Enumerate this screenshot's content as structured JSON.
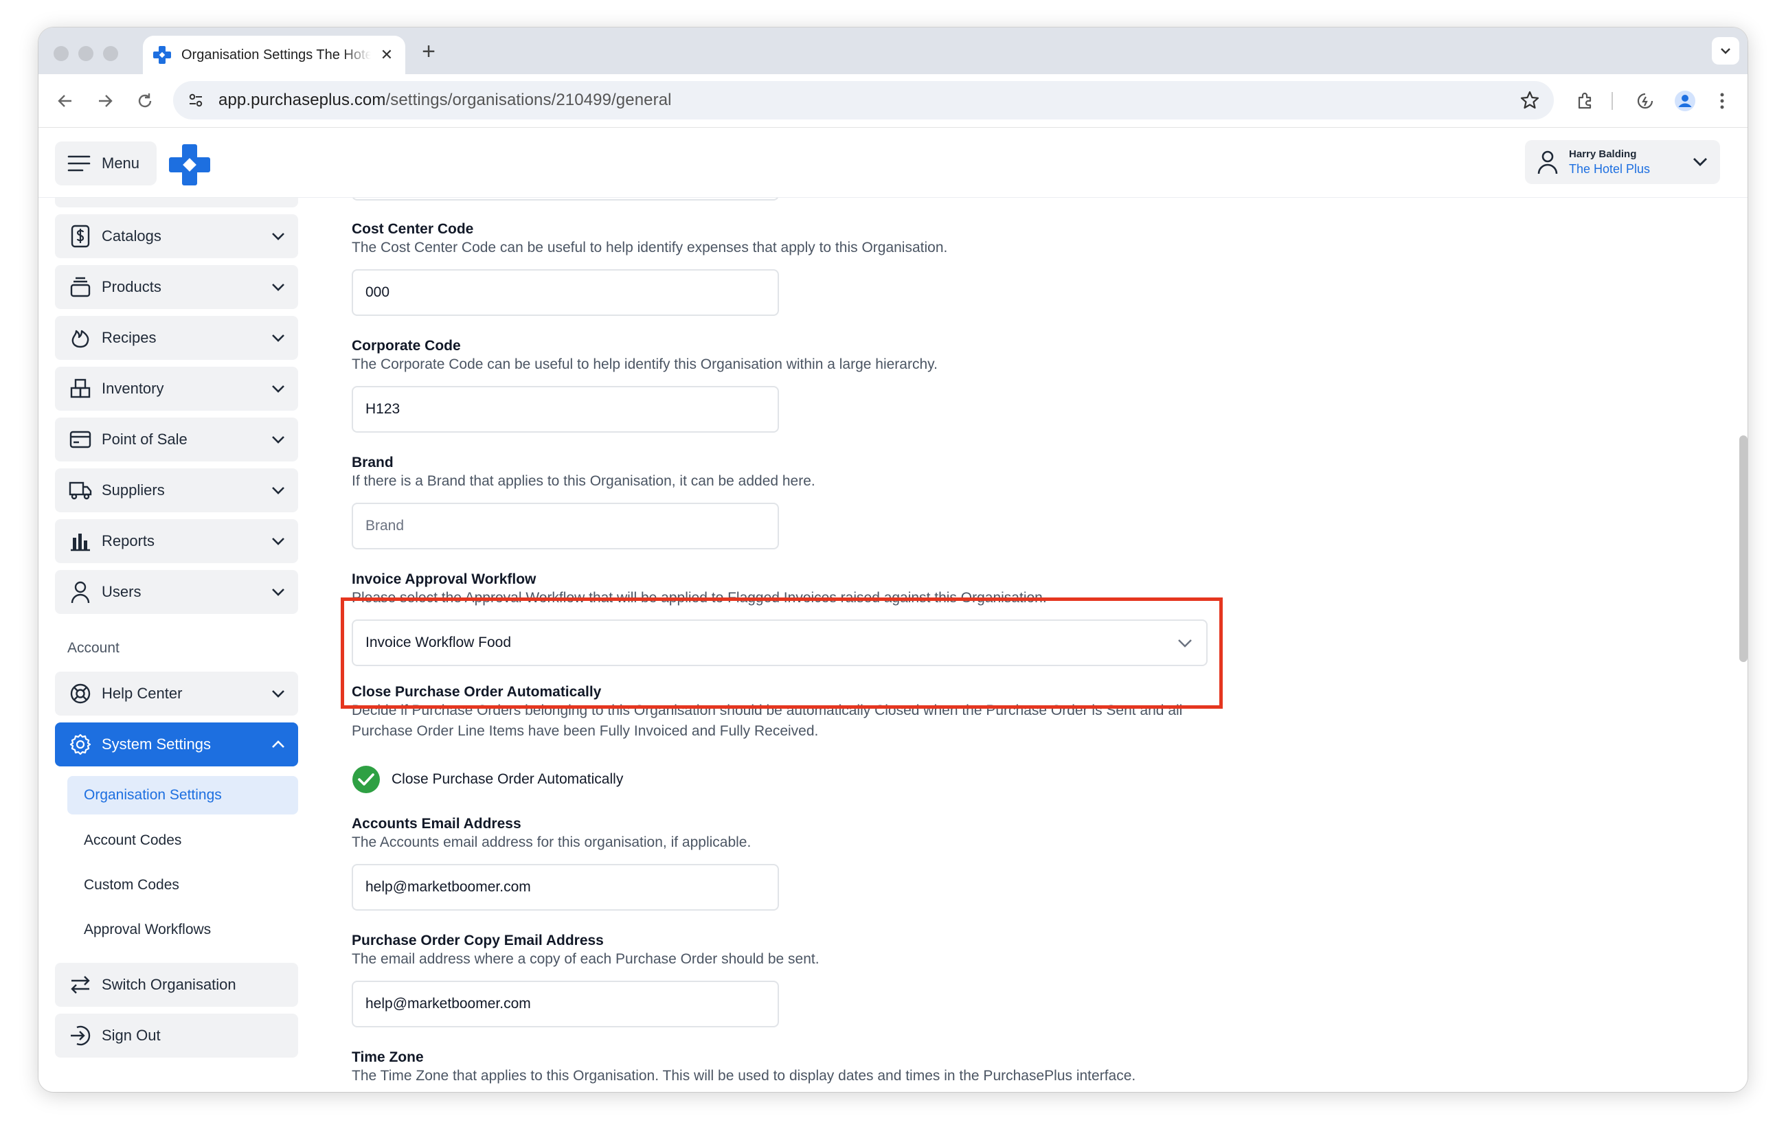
{
  "browser": {
    "tab_title": "Organisation Settings The Hotel Plus",
    "url_host": "app.purchaseplus.com",
    "url_path": "/settings/organisations/210499/general"
  },
  "header": {
    "menu_label": "Menu",
    "user_name": "Harry Balding",
    "user_org": "The Hotel Plus"
  },
  "sidebar": {
    "items": [
      {
        "label": "Catalogs",
        "icon": "dollar-doc-icon"
      },
      {
        "label": "Products",
        "icon": "stack-icon"
      },
      {
        "label": "Recipes",
        "icon": "flame-icon"
      },
      {
        "label": "Inventory",
        "icon": "boxes-icon"
      },
      {
        "label": "Point of Sale",
        "icon": "card-icon"
      },
      {
        "label": "Suppliers",
        "icon": "truck-icon"
      },
      {
        "label": "Reports",
        "icon": "bar-chart-icon"
      },
      {
        "label": "Users",
        "icon": "user-icon"
      }
    ],
    "account_heading": "Account",
    "help_center": "Help Center",
    "system_settings": "System Settings",
    "sub_items": [
      "Organisation Settings",
      "Account Codes",
      "Custom Codes",
      "Approval Workflows"
    ],
    "switch_org": "Switch Organisation",
    "sign_out": "Sign Out"
  },
  "form": {
    "cost_center": {
      "title": "Cost Center Code",
      "desc": "The Cost Center Code can be useful to help identify expenses that apply to this Organisation.",
      "value": "000"
    },
    "corporate_code": {
      "title": "Corporate Code",
      "desc": "The Corporate Code can be useful to help identify this Organisation within a large hierarchy.",
      "value": "H123"
    },
    "brand": {
      "title": "Brand",
      "desc": "If there is a Brand that applies to this Organisation, it can be added here.",
      "placeholder": "Brand"
    },
    "invoice_workflow": {
      "title": "Invoice Approval Workflow",
      "desc": "Please select the Approval Workflow that will be applied to Flagged Invoices raised against this Organisation.",
      "value": "Invoice Workflow Food"
    },
    "close_po": {
      "title": "Close Purchase Order Automatically",
      "desc": "Decide if Purchase Orders belonging to this Organisation should be automatically Closed when the Purchase Order is Sent and all Purchase Order Line Items have been Fully Invoiced and Fully Received.",
      "checkbox_label": "Close Purchase Order Automatically",
      "checked": true
    },
    "accounts_email": {
      "title": "Accounts Email Address",
      "desc": "The Accounts email address for this organisation, if applicable.",
      "value": "help@marketboomer.com"
    },
    "po_copy_email": {
      "title": "Purchase Order Copy Email Address",
      "desc": "The email address where a copy of each Purchase Order should be sent.",
      "value": "help@marketboomer.com"
    },
    "time_zone": {
      "title": "Time Zone",
      "desc": "The Time Zone that applies to this Organisation. This will be used to display dates and times in the PurchasePlus interface."
    }
  },
  "colors": {
    "accent": "#1d6fe0",
    "highlight": "#e5361f",
    "success": "#2ea043"
  }
}
